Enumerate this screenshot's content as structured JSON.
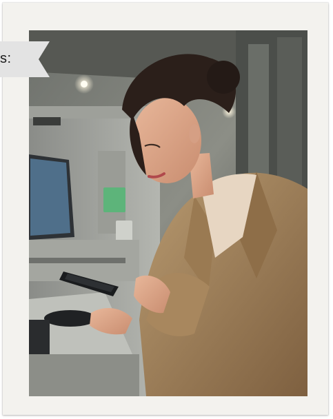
{
  "label_tag": {
    "text": "s:"
  },
  "photo": {
    "subject": "woman-using-smartphone-at-atm"
  },
  "colors": {
    "frame": "#f3f2ee",
    "tag": "#e3e3e3",
    "coat": "#a8875e",
    "sweater": "#e7d6c2",
    "screen": "#4f6f8a"
  }
}
